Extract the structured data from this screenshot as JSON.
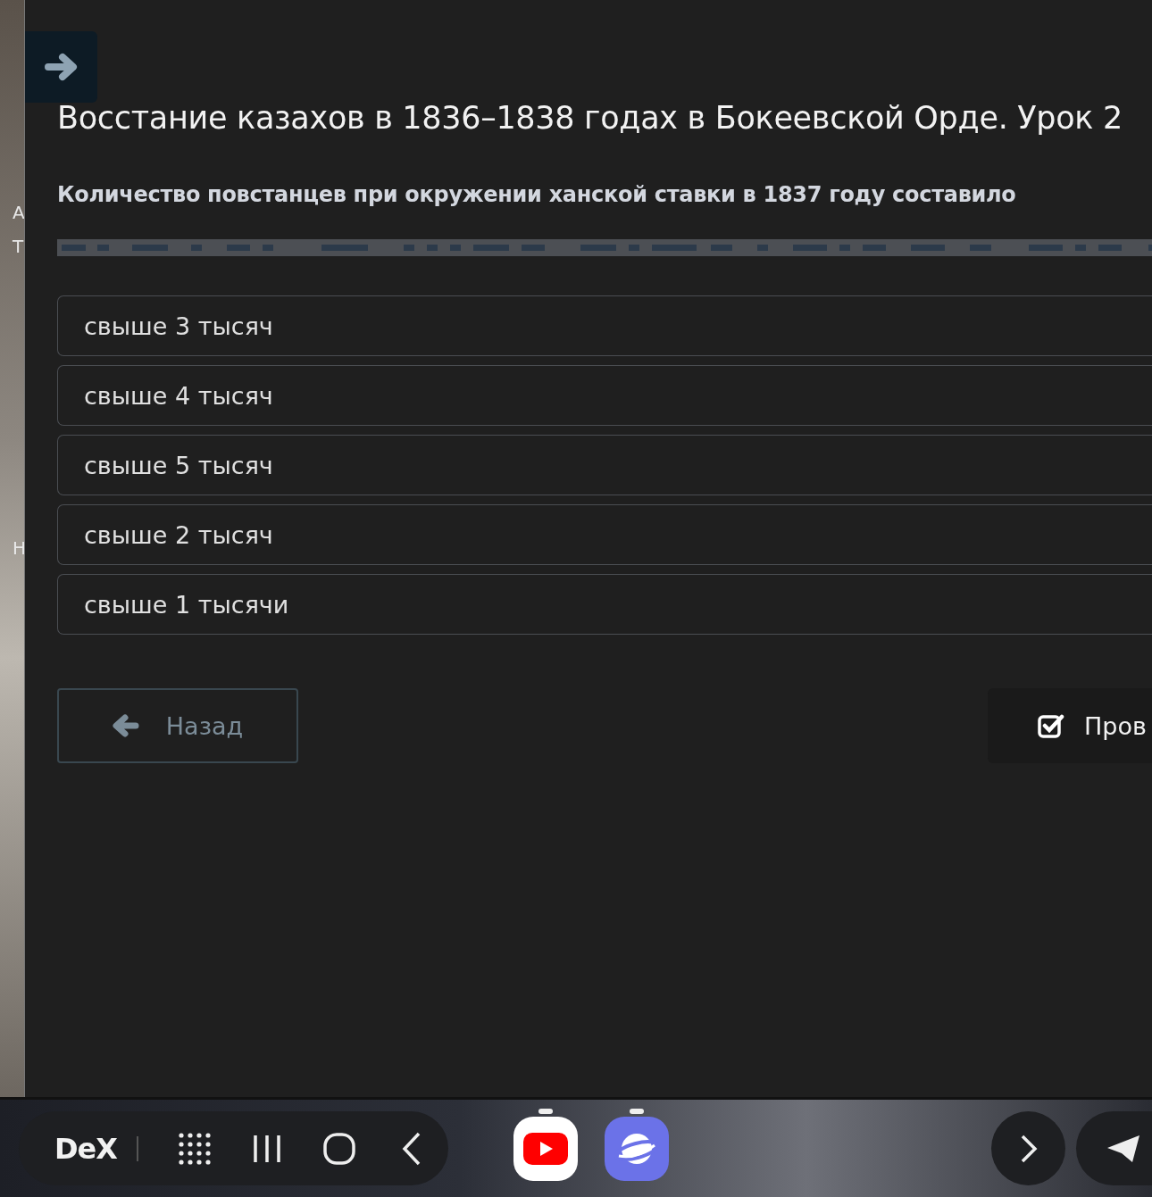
{
  "background_fragments": [
    "А",
    "Т",
    "Н"
  ],
  "lesson": {
    "title": "Восстание казахов в 1836–1838 годах в Бокеевской Орде. Урок 2",
    "question": "Количество повстанцев при окружении ханской ставки в 1837 году составило"
  },
  "answers": [
    {
      "label": "свыше 3 тысяч",
      "selected": false
    },
    {
      "label": "свыше 4 тысяч",
      "selected": false
    },
    {
      "label": "свыше 5 тысяч",
      "selected": false
    },
    {
      "label": "свыше 2 тысяч",
      "selected": false
    },
    {
      "label": "свыше 1 тысячи",
      "selected": false
    }
  ],
  "buttons": {
    "back": "Назад",
    "check": "Пров"
  },
  "taskbar": {
    "logo": "DeX"
  }
}
